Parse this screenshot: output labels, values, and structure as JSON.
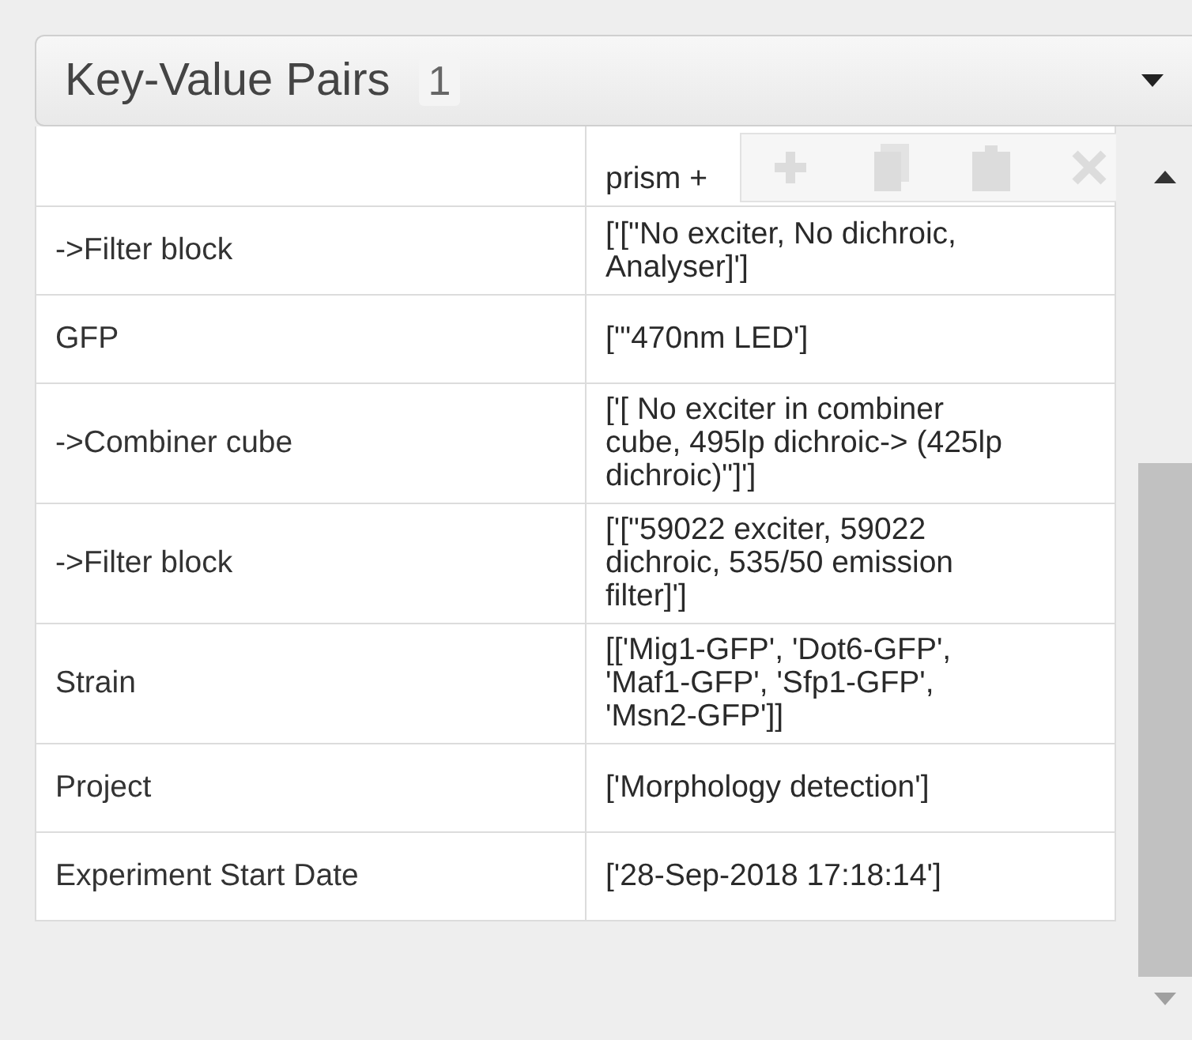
{
  "panel": {
    "title": "Key-Value Pairs",
    "count": "1"
  },
  "rows": [
    {
      "value": "prism +"
    },
    {
      "key": "->Filter block",
      "value": "['[\"No exciter, No dichroic, Analyser]']"
    },
    {
      "key": "GFP",
      "value": "['\"470nm LED']"
    },
    {
      "key": "->Combiner cube",
      "value": "['[ No exciter in combiner cube, 495lp dichroic-> (425lp dichroic)\"]']"
    },
    {
      "key": "->Filter block",
      "value": "['[\"59022 exciter, 59022 dichroic, 535/50 emission filter]']"
    },
    {
      "key": "Strain",
      "value": "[['Mig1-GFP', 'Dot6-GFP', 'Maf1-GFP', 'Sfp1-GFP', 'Msn2-GFP']]"
    },
    {
      "key": "Project",
      "value": "['Morphology detection']"
    },
    {
      "key": "Experiment Start Date",
      "value": "['28-Sep-2018 17:18:14']"
    }
  ],
  "toolbar": [
    {
      "kind": "add",
      "disabled": true
    },
    {
      "kind": "copy",
      "disabled": true
    },
    {
      "kind": "paste",
      "disabled": true
    },
    {
      "kind": "delete",
      "disabled": true
    }
  ]
}
